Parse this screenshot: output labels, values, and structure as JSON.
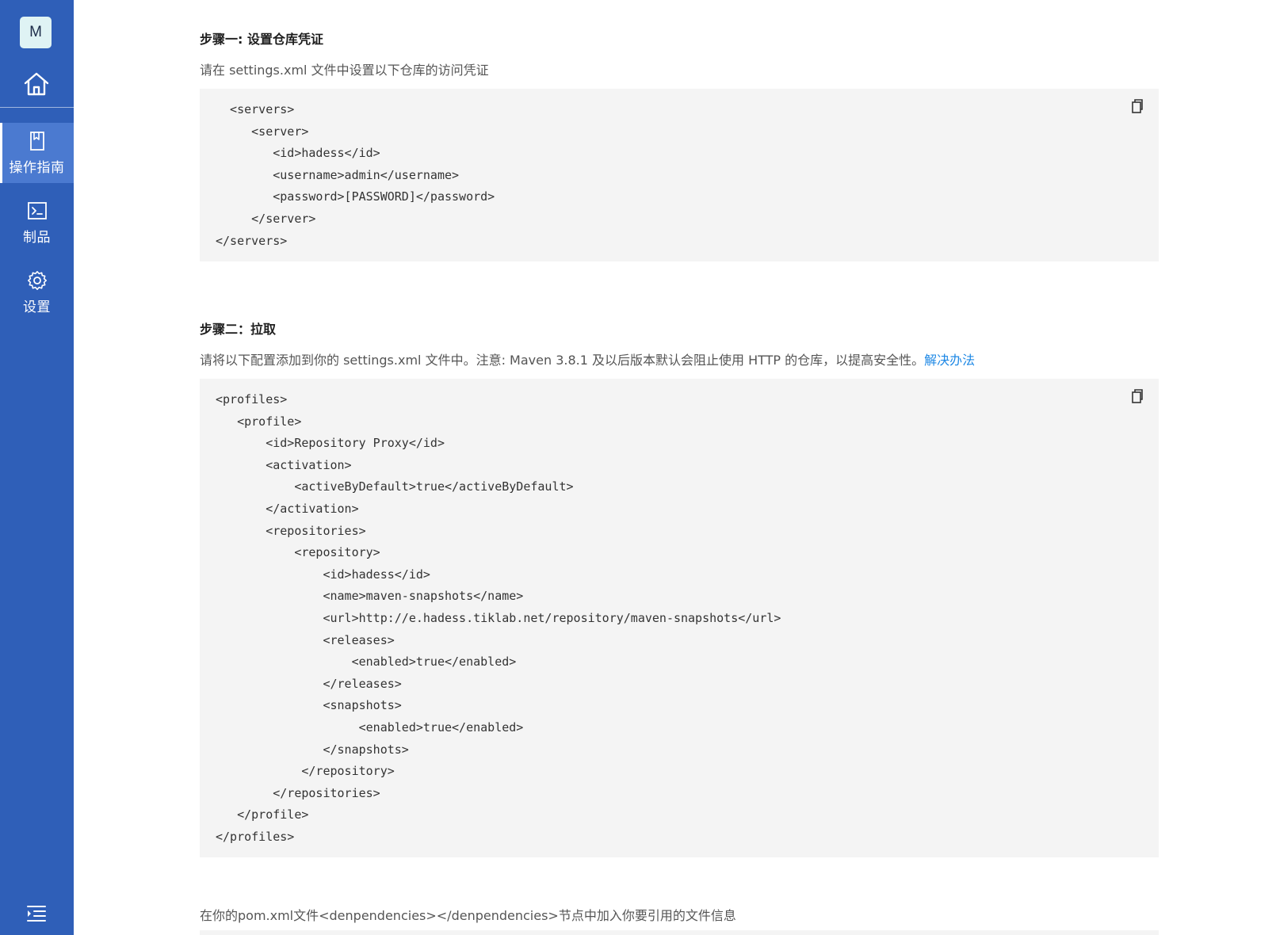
{
  "sidebar": {
    "avatar_letter": "M",
    "items": [
      {
        "label": "操作指南",
        "icon": "book-icon",
        "active": true
      },
      {
        "label": "制品",
        "icon": "terminal-icon",
        "active": false
      },
      {
        "label": "设置",
        "icon": "gear-icon",
        "active": false
      }
    ]
  },
  "steps": {
    "step1": {
      "title": "步骤一: 设置仓库凭证",
      "description": "请在 settings.xml 文件中设置以下仓库的访问凭证",
      "code": "  <servers>\n     <server>\n        <id>hadess</id>\n        <username>admin</username>\n        <password>[PASSWORD]</password>\n     </server>\n</servers>"
    },
    "step2": {
      "title": "步骤二：拉取",
      "description": "请将以下配置添加到你的 settings.xml 文件中。注意: Maven 3.8.1 及以后版本默认会阻止使用 HTTP 的仓库，以提高安全性。",
      "link_text": "解决办法",
      "code": "<profiles>\n   <profile>\n       <id>Repository Proxy</id>\n       <activation>\n           <activeByDefault>true</activeByDefault>\n       </activation>\n       <repositories>\n           <repository>\n               <id>hadess</id>\n               <name>maven-snapshots</name>\n               <url>http://e.hadess.tiklab.net/repository/maven-snapshots</url>\n               <releases>\n                   <enabled>true</enabled>\n               </releases>\n               <snapshots>\n                    <enabled>true</enabled>\n               </snapshots>\n            </repository>\n        </repositories>\n   </profile>\n</profiles>"
    },
    "step3": {
      "description": "在你的pom.xml文件<denpendencies></denpendencies>节点中加入你要引用的文件信息"
    }
  },
  "colors": {
    "sidebar_bg": "#2f5fb8",
    "sidebar_active": "#4b7ad0",
    "code_bg": "#f4f4f4",
    "link": "#1e88e5"
  }
}
